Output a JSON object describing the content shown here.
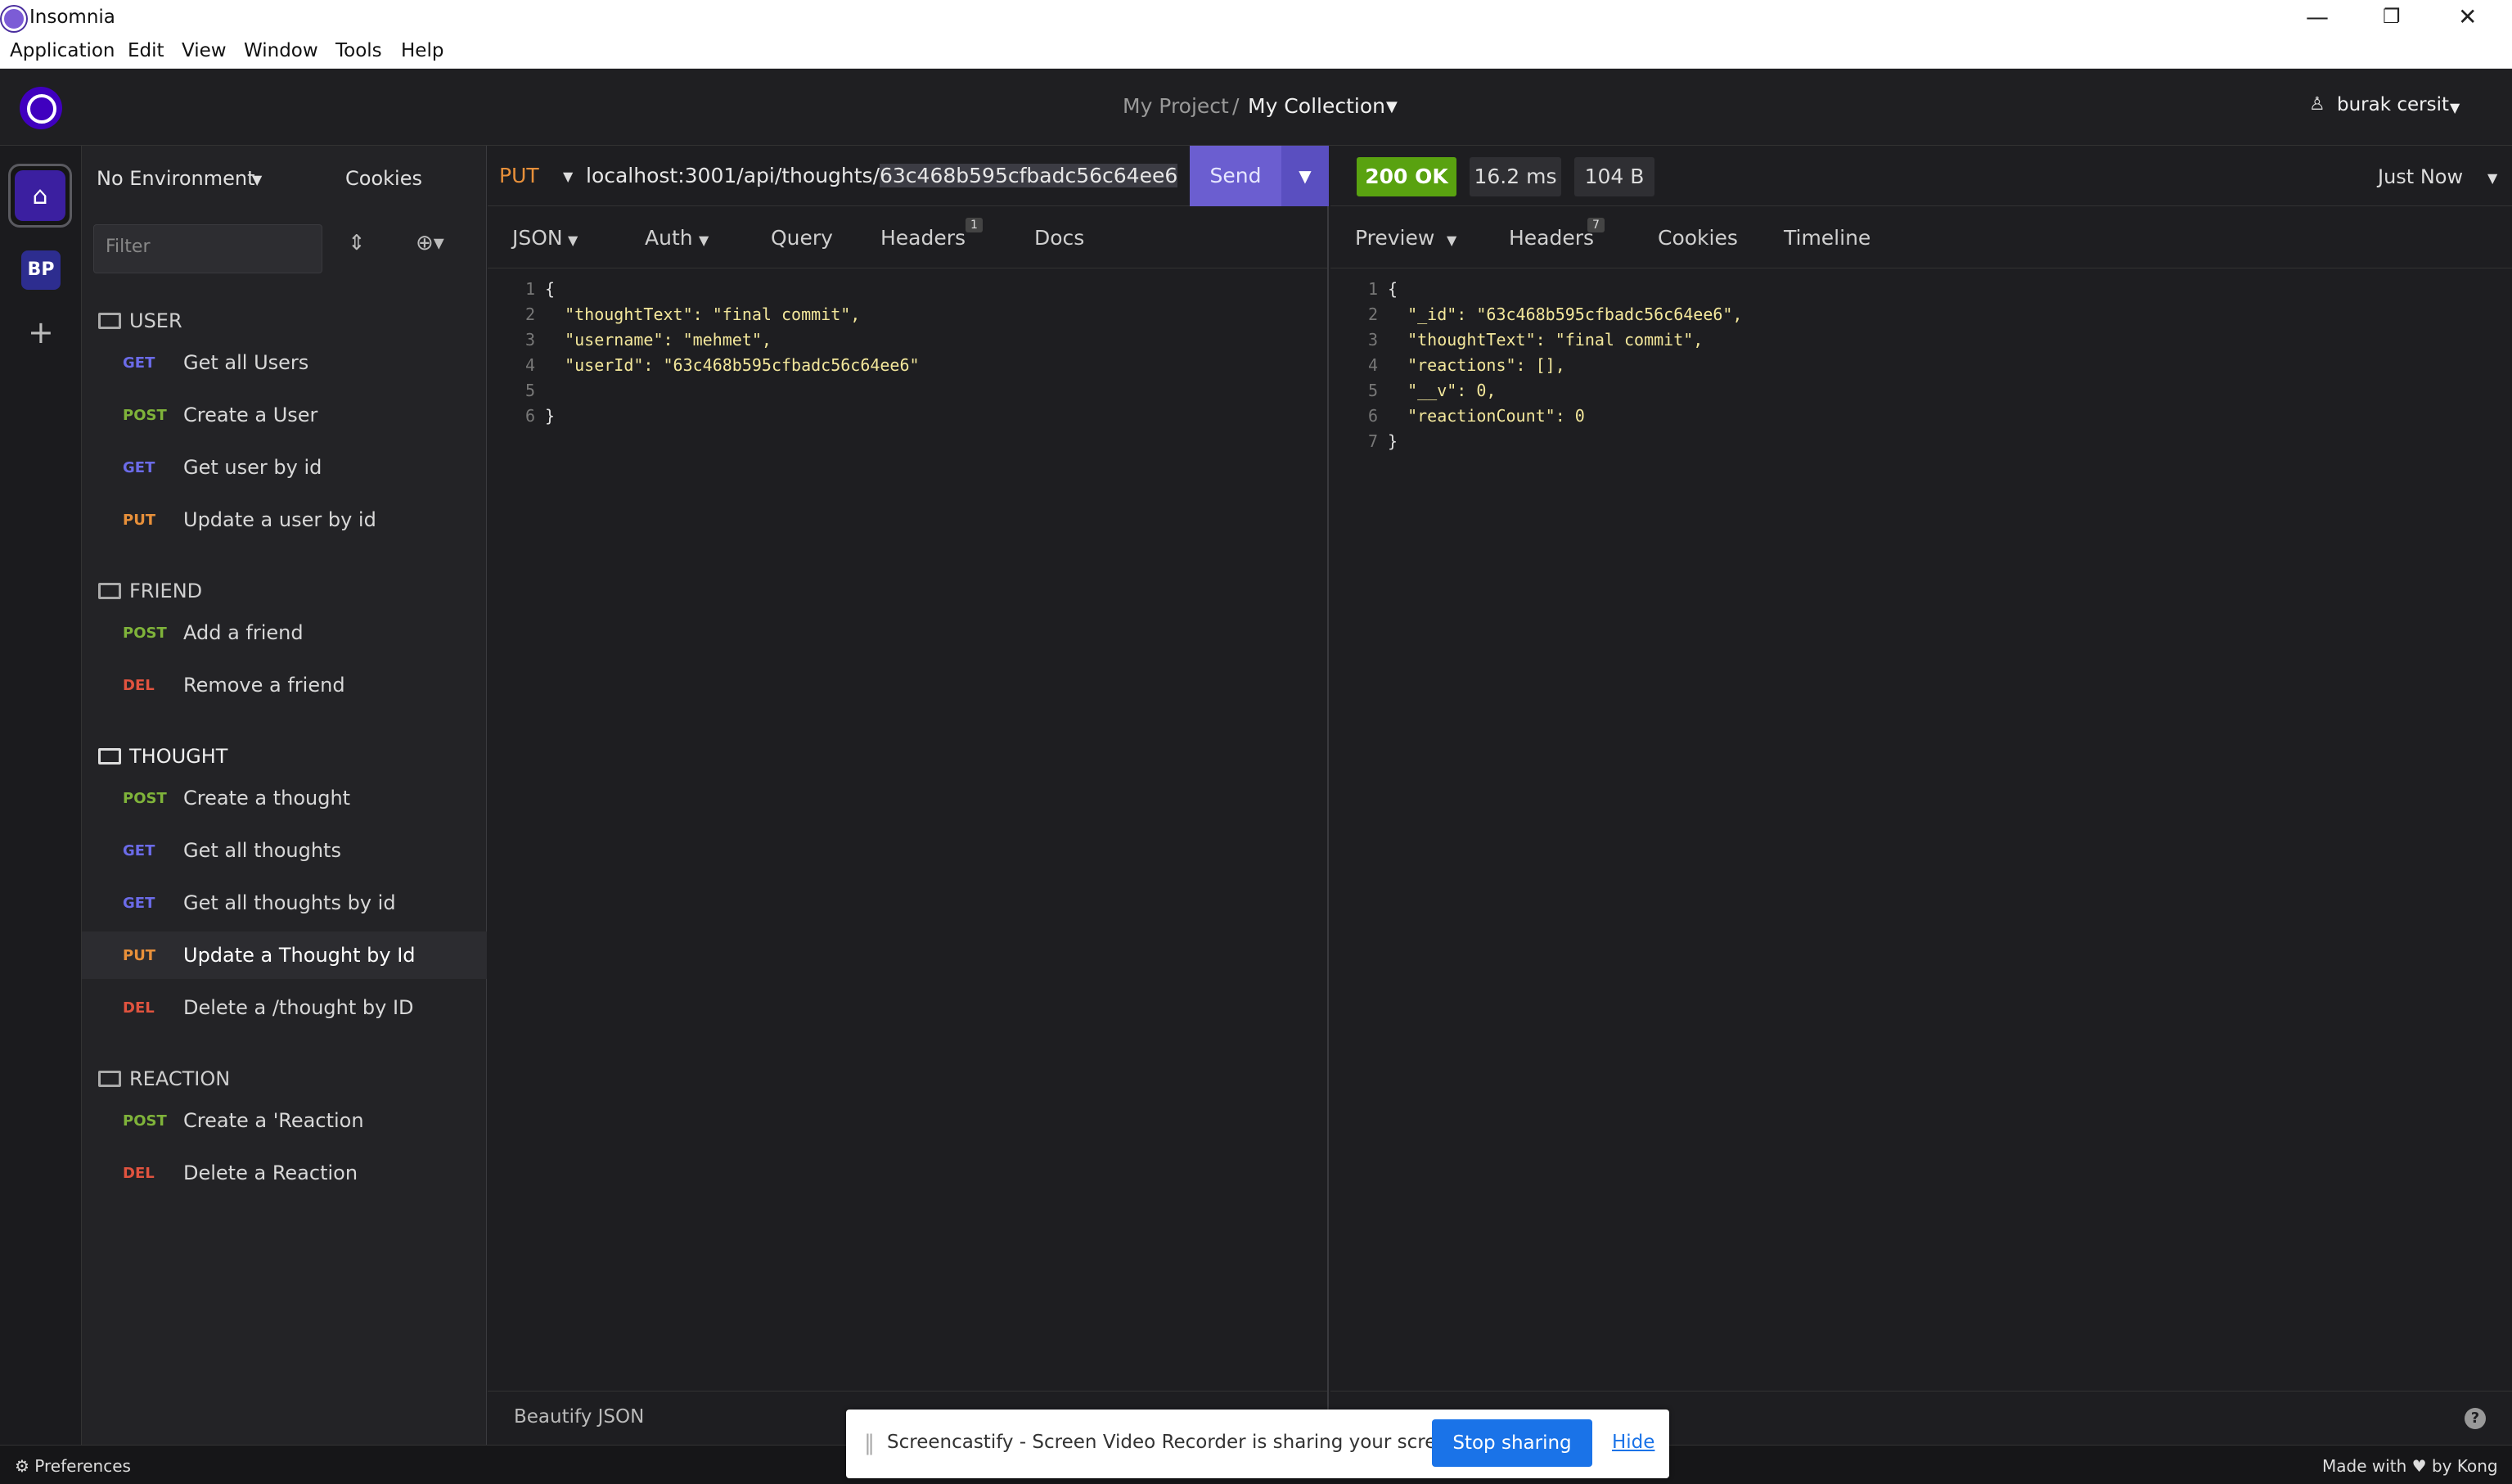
{
  "window": {
    "title": "Insomnia",
    "controls": {
      "minimize": "—",
      "restore": "❐",
      "close": "✕"
    }
  },
  "menu": [
    "Application",
    "Edit",
    "View",
    "Window",
    "Tools",
    "Help"
  ],
  "header": {
    "project": "My Project",
    "separator": "/",
    "collection": "My Collection",
    "user": "burak cersit"
  },
  "rail": {
    "workspace_badge": "BP"
  },
  "sidebar": {
    "environment": "No Environment",
    "cookies": "Cookies",
    "filter_placeholder": "Filter",
    "folders": [
      {
        "name": "USER",
        "requests": [
          {
            "method": "GET",
            "name": "Get all Users"
          },
          {
            "method": "POST",
            "name": "Create a User"
          },
          {
            "method": "GET",
            "name": "Get user by id"
          },
          {
            "method": "PUT",
            "name": "Update a user by id"
          }
        ]
      },
      {
        "name": "FRIEND",
        "requests": [
          {
            "method": "POST",
            "name": "Add a friend"
          },
          {
            "method": "DEL",
            "name": "Remove a friend"
          }
        ]
      },
      {
        "name": "THOUGHT",
        "requests": [
          {
            "method": "POST",
            "name": "Create a thought"
          },
          {
            "method": "GET",
            "name": "Get all thoughts"
          },
          {
            "method": "GET",
            "name": "Get all thoughts by id"
          },
          {
            "method": "PUT",
            "name": "Update a Thought by Id"
          },
          {
            "method": "DEL",
            "name": "Delete a /thought by ID"
          }
        ]
      },
      {
        "name": "REACTION",
        "requests": [
          {
            "method": "POST",
            "name": "Create a 'Reaction"
          },
          {
            "method": "DEL",
            "name": "Delete a Reaction"
          }
        ]
      }
    ]
  },
  "request": {
    "method": "PUT",
    "url_base": "localhost:3001/api/thoughts/",
    "url_id": "63c468b595cfbadc56c64ee6",
    "send": "Send",
    "tabs": {
      "body": "JSON",
      "auth": "Auth",
      "query": "Query",
      "headers": "Headers",
      "headers_count": "1",
      "docs": "Docs"
    },
    "body_lines": [
      "{",
      "  \"thoughtText\": \"final commit\",",
      "  \"username\": \"mehmet\",",
      "  \"userId\": \"63c468b595cfbadc56c64ee6\"",
      "",
      "}"
    ],
    "beautify": "Beautify JSON"
  },
  "response": {
    "status": "200 OK",
    "time": "16.2 ms",
    "size": "104 B",
    "when": "Just Now",
    "tabs": {
      "preview": "Preview",
      "headers": "Headers",
      "headers_count": "7",
      "cookies": "Cookies",
      "timeline": "Timeline"
    },
    "body_lines": [
      "{",
      "  \"_id\": \"63c468b595cfbadc56c64ee6\",",
      "  \"thoughtText\": \"final commit\",",
      "  \"reactions\": [],",
      "  \"__v\": 0,",
      "  \"reactionCount\": 0",
      "}"
    ]
  },
  "footer": {
    "preferences": "Preferences",
    "made_with": "Made with ♥ by Kong"
  },
  "screencast": {
    "message": "Screencastify - Screen Video Recorder is sharing your screen.",
    "stop": "Stop sharing",
    "hide": "Hide"
  },
  "colors": {
    "accent": "#6b5ed0",
    "ok": "#59a210",
    "get": "#6b6be8",
    "post": "#7fb33a",
    "put": "#e8903a",
    "del": "#e0533f"
  }
}
